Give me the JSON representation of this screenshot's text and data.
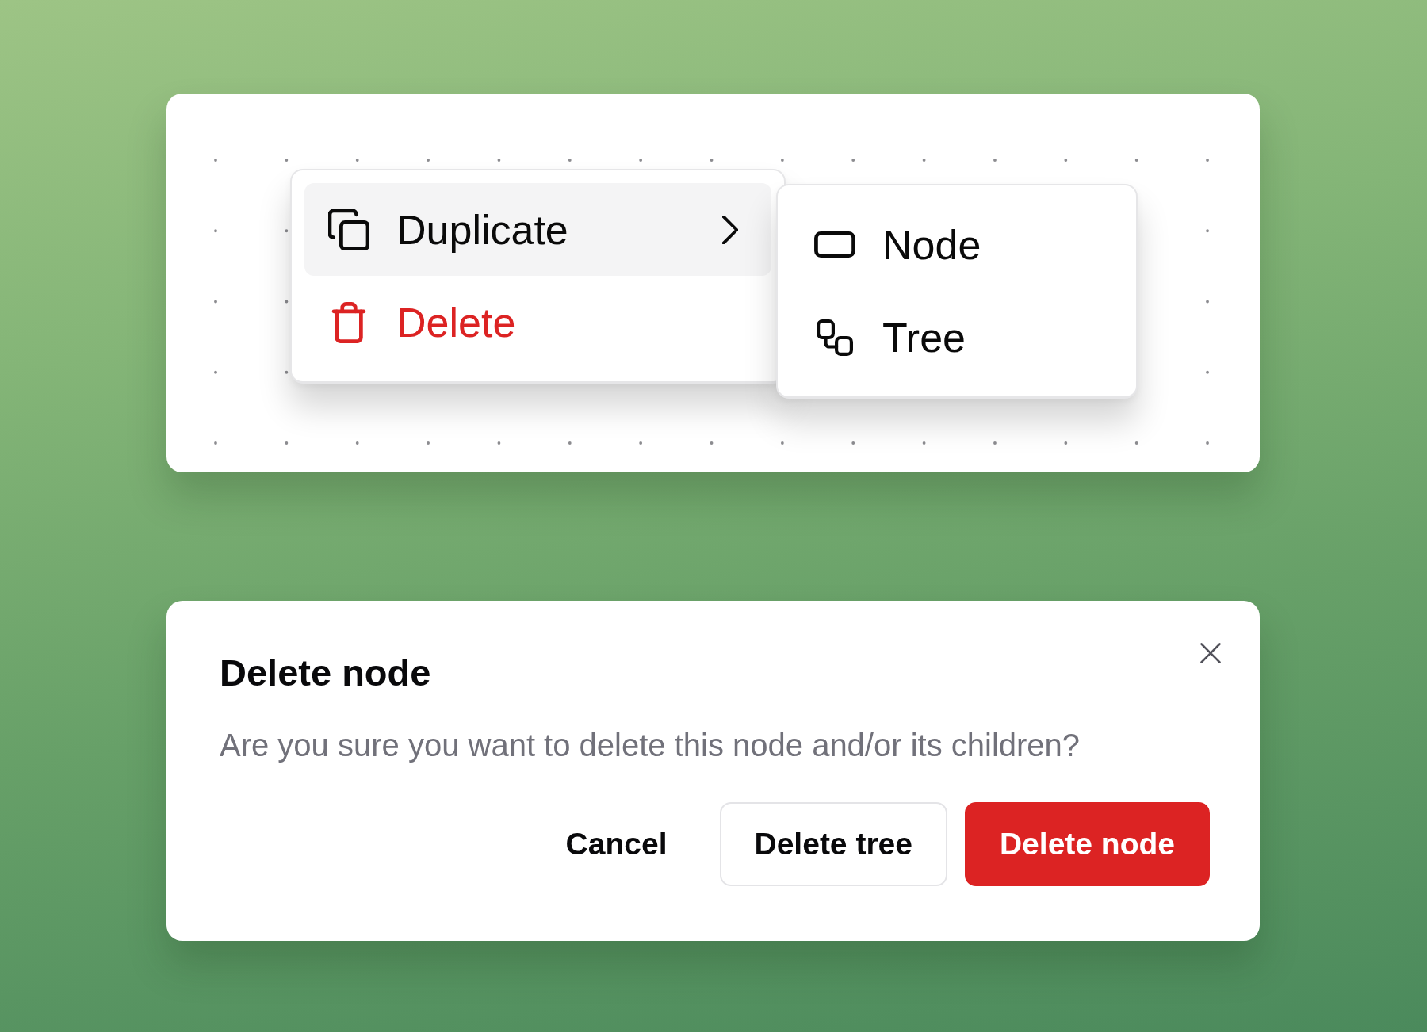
{
  "canvas": {
    "context_menu": {
      "items": [
        {
          "label": "Duplicate",
          "kind": "submenu",
          "selected": true
        },
        {
          "label": "Delete",
          "kind": "destructive",
          "selected": false
        }
      ]
    },
    "submenu": {
      "items": [
        {
          "label": "Node",
          "selected": false
        },
        {
          "label": "Tree",
          "selected": false
        }
      ]
    }
  },
  "dialog": {
    "title": "Delete node",
    "message": "Are you sure you want to delete this node and/or its children?",
    "buttons": [
      {
        "label": "Cancel",
        "kind": "ghost"
      },
      {
        "label": "Delete tree",
        "kind": "outline"
      },
      {
        "label": "Delete node",
        "kind": "destructive"
      }
    ]
  }
}
